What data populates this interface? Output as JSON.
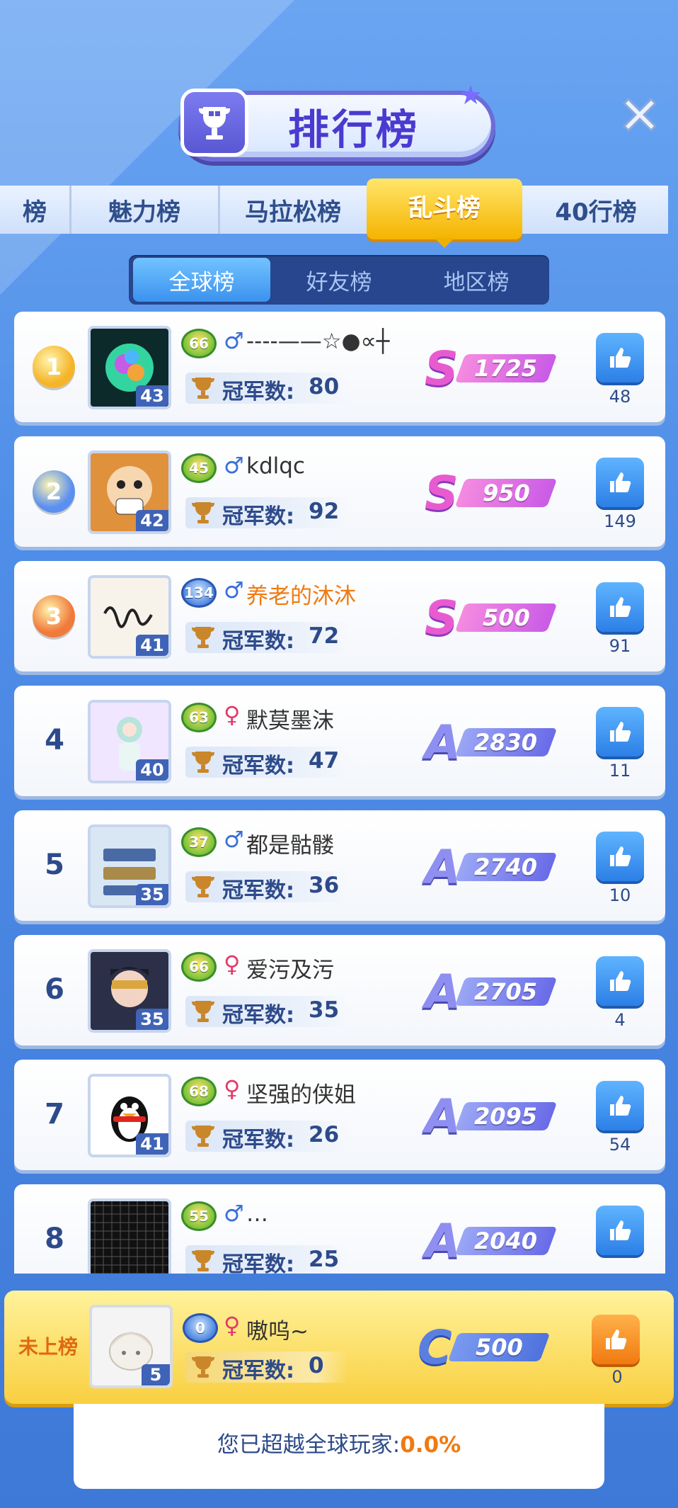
{
  "header": {
    "title": "排行榜"
  },
  "tabs": [
    {
      "label": "榜",
      "active": false
    },
    {
      "label": "魅力榜",
      "active": false
    },
    {
      "label": "马拉松榜",
      "active": false
    },
    {
      "label": "乱斗榜",
      "active": true
    },
    {
      "label": "40行榜",
      "active": false
    }
  ],
  "subtabs": [
    {
      "label": "全球榜",
      "active": true
    },
    {
      "label": "好友榜",
      "active": false
    },
    {
      "label": "地区榜",
      "active": false
    }
  ],
  "champ_label": "冠军数:",
  "rows": [
    {
      "rank": "1",
      "level_avatar": "43",
      "level_badge": "66",
      "gender": "♂",
      "name": "----——☆●∝┼",
      "champions": "80",
      "grade": "S",
      "score": "1725",
      "likes": "48",
      "avatar_icon": "crystal-egg-icon",
      "name_color": "#333333"
    },
    {
      "rank": "2",
      "level_avatar": "42",
      "level_badge": "45",
      "gender": "♂",
      "name": "kdlqc",
      "champions": "92",
      "grade": "S",
      "score": "950",
      "likes": "149",
      "avatar_icon": "cartoon-face-icon",
      "name_color": "#333333"
    },
    {
      "rank": "3",
      "level_avatar": "41",
      "level_badge": "134",
      "gender": "♂",
      "name": "养老的沐沐",
      "champions": "72",
      "grade": "S",
      "score": "500",
      "likes": "91",
      "avatar_icon": "handwriting-icon",
      "name_color": "#f07a10"
    },
    {
      "rank": "4",
      "level_avatar": "40",
      "level_badge": "63",
      "gender": "♀",
      "name": "默莫墨沫",
      "champions": "47",
      "grade": "A",
      "score": "2830",
      "likes": "11",
      "avatar_icon": "anime-girl-icon",
      "name_color": "#333333"
    },
    {
      "rank": "5",
      "level_avatar": "35",
      "level_badge": "37",
      "gender": "♂",
      "name": "都是骷髅",
      "champions": "36",
      "grade": "A",
      "score": "2740",
      "likes": "10",
      "avatar_icon": "license-plate-icon",
      "name_color": "#333333"
    },
    {
      "rank": "6",
      "level_avatar": "35",
      "level_badge": "66",
      "gender": "♀",
      "name": "爱污及污",
      "champions": "35",
      "grade": "A",
      "score": "2705",
      "likes": "4",
      "avatar_icon": "masked-girl-icon",
      "name_color": "#333333"
    },
    {
      "rank": "7",
      "level_avatar": "41",
      "level_badge": "68",
      "gender": "♀",
      "name": "坚强的侠姐",
      "champions": "26",
      "grade": "A",
      "score": "2095",
      "likes": "54",
      "avatar_icon": "penguin-icon",
      "name_color": "#333333"
    },
    {
      "rank": "8",
      "level_avatar": "",
      "level_badge": "55",
      "gender": "♂",
      "name": "…",
      "champions": "25",
      "grade": "A",
      "score": "2040",
      "likes": "",
      "avatar_icon": "grid-icon",
      "name_color": "#333333"
    }
  ],
  "me": {
    "status": "未上榜",
    "level_avatar": "5",
    "level_badge": "0",
    "gender": "♀",
    "name": "嗷呜~",
    "champions": "0",
    "grade": "C",
    "score": "500",
    "likes": "0"
  },
  "footer": {
    "prefix": "您已超越全球玩家:",
    "percent": "0.0%"
  },
  "colors": {
    "male": "#3b6fd8",
    "female": "#e23a6a",
    "grade_s": "#e85bd0",
    "grade_a": "#6a6be8",
    "grade_c": "#5b7fe0"
  }
}
